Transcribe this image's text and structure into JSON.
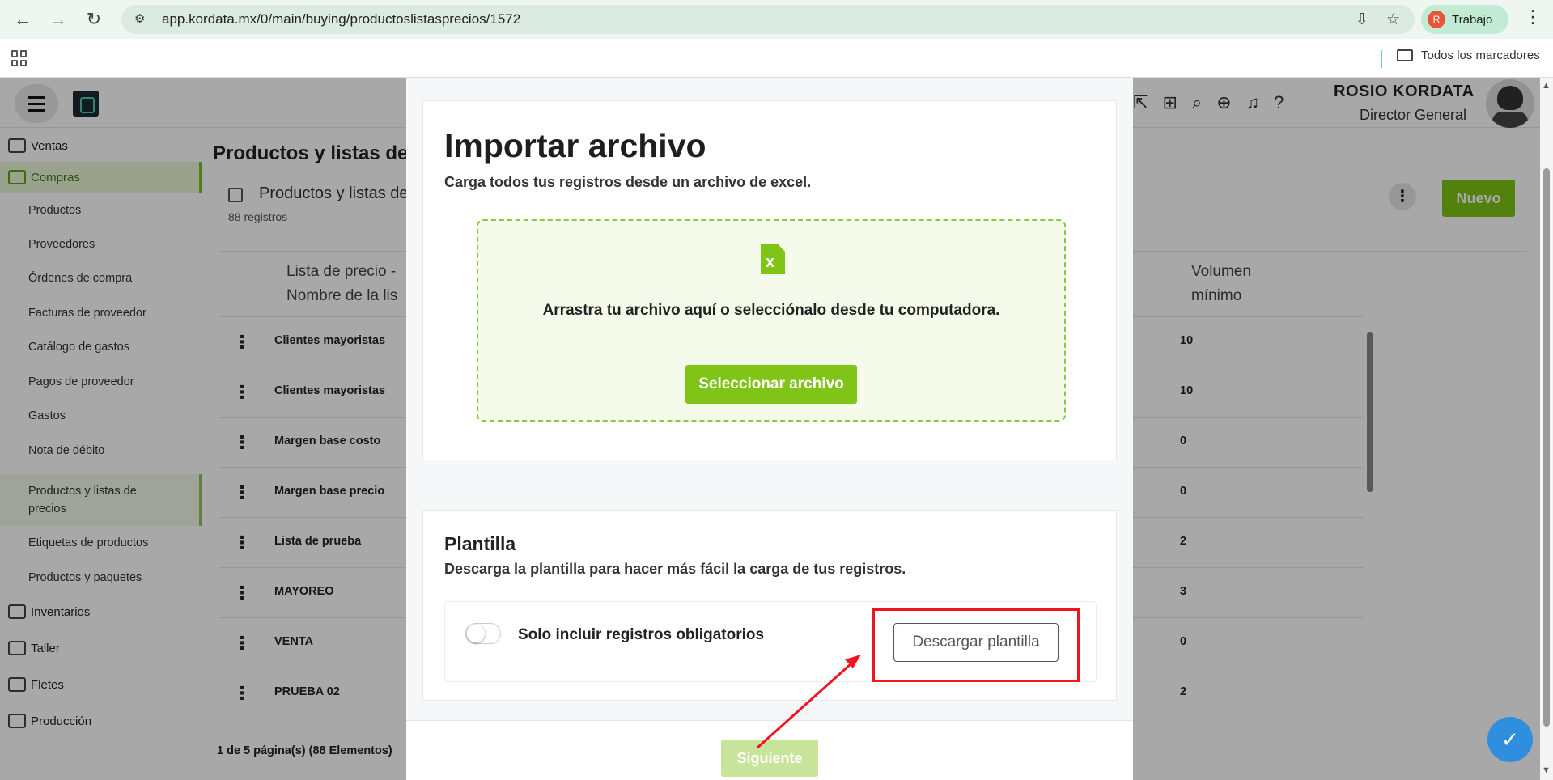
{
  "browser": {
    "url": "app.kordata.mx/0/main/buying/productoslistasprecios/1572",
    "profile_initial": "R",
    "profile_name": "Trabajo",
    "bookmarks_all": "Todos los marcadores"
  },
  "header": {
    "user_name": "ROSIO KORDATA",
    "user_role": "Director General"
  },
  "sidebar": {
    "items": [
      {
        "label": "Ventas",
        "type": "main"
      },
      {
        "label": "Compras",
        "type": "main",
        "active": true
      },
      {
        "label": "Productos",
        "type": "sub"
      },
      {
        "label": "Proveedores",
        "type": "sub"
      },
      {
        "label": "Órdenes de compra",
        "type": "sub"
      },
      {
        "label": "Facturas de proveedor",
        "type": "sub"
      },
      {
        "label": "Catálogo de gastos",
        "type": "sub"
      },
      {
        "label": "Pagos de proveedor",
        "type": "sub"
      },
      {
        "label": "Gastos",
        "type": "sub"
      },
      {
        "label": "Nota de débito",
        "type": "sub"
      },
      {
        "label": "Productos y listas de precios",
        "type": "sub",
        "selected": true
      },
      {
        "label": "Etiquetas de productos",
        "type": "sub"
      },
      {
        "label": "Productos y paquetes",
        "type": "sub"
      },
      {
        "label": "Inventarios",
        "type": "main"
      },
      {
        "label": "Taller",
        "type": "main"
      },
      {
        "label": "Fletes",
        "type": "main"
      },
      {
        "label": "Producción",
        "type": "main"
      }
    ]
  },
  "page": {
    "title": "Productos y listas de",
    "card_title": "Productos y listas de",
    "record_count": "88 registros",
    "new_button": "Nuevo",
    "pager": "1 de 5 página(s) (88 Elementos)"
  },
  "table": {
    "col_a_line1": "Lista de precio -",
    "col_a_line2": "Nombre de la lis",
    "col_b_line1": "Volumen",
    "col_b_line2": "mínimo",
    "rows": [
      {
        "name": "Clientes mayoristas",
        "volume": "10"
      },
      {
        "name": "Clientes mayoristas",
        "volume": "10"
      },
      {
        "name": "Margen base costo",
        "volume": "0"
      },
      {
        "name": "Margen base precio",
        "volume": "0"
      },
      {
        "name": "Lista de prueba",
        "volume": "2"
      },
      {
        "name": "MAYOREO",
        "volume": "3"
      },
      {
        "name": "VENTA",
        "volume": "0"
      },
      {
        "name": "PRUEBA 02",
        "volume": "2"
      }
    ]
  },
  "modal": {
    "title": "Importar archivo",
    "subtitle": "Carga todos tus registros desde un archivo de excel.",
    "drop_text": "Arrastra tu archivo aquí o selecciónalo desde tu computadora.",
    "select_button": "Seleccionar archivo",
    "template_title": "Plantilla",
    "template_subtitle": "Descarga la plantilla para hacer más fácil la carga de tus registros.",
    "toggle_label": "Solo incluir registros obligatorios",
    "toggle_on": false,
    "download_button": "Descargar plantilla",
    "next_button": "Siguiente"
  },
  "colors": {
    "accent": "#7fc416",
    "highlight": "#f0141e"
  }
}
